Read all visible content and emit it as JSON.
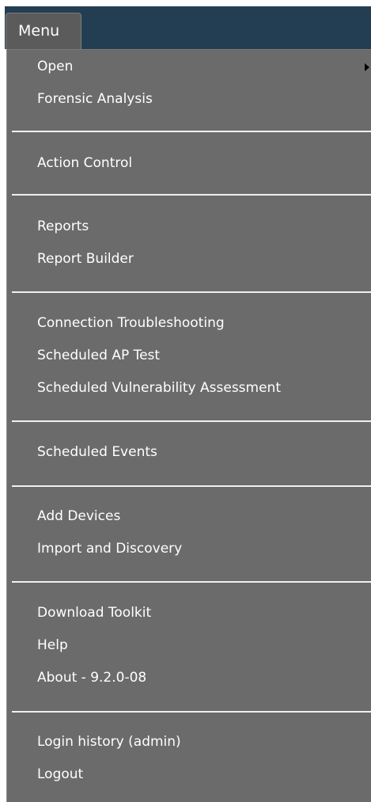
{
  "menu": {
    "button_label": "Menu"
  },
  "dropdown": {
    "groups": [
      {
        "items": [
          {
            "label": "Open",
            "has_submenu": true
          },
          {
            "label": "Forensic Analysis"
          }
        ]
      },
      {
        "items": [
          {
            "label": "Action Control"
          }
        ]
      },
      {
        "items": [
          {
            "label": "Reports"
          },
          {
            "label": "Report Builder"
          }
        ]
      },
      {
        "items": [
          {
            "label": "Connection Troubleshooting"
          },
          {
            "label": "Scheduled AP Test"
          },
          {
            "label": "Scheduled Vulnerability Assessment"
          }
        ]
      },
      {
        "items": [
          {
            "label": "Scheduled Events"
          }
        ]
      },
      {
        "items": [
          {
            "label": "Add Devices"
          },
          {
            "label": "Import and Discovery"
          }
        ]
      },
      {
        "items": [
          {
            "label": "Download Toolkit"
          },
          {
            "label": "Help"
          },
          {
            "label": "About - 9.2.0-08"
          }
        ]
      },
      {
        "items": [
          {
            "label": "Login history (admin)"
          },
          {
            "label": "Logout"
          }
        ]
      }
    ]
  },
  "colors": {
    "topbar": "#233e52",
    "menu_background": "#6b6b6b",
    "menu_text": "#ffffff",
    "separator": "#f0f0f0"
  },
  "icons": {
    "submenu": "submenu-arrow-icon"
  }
}
